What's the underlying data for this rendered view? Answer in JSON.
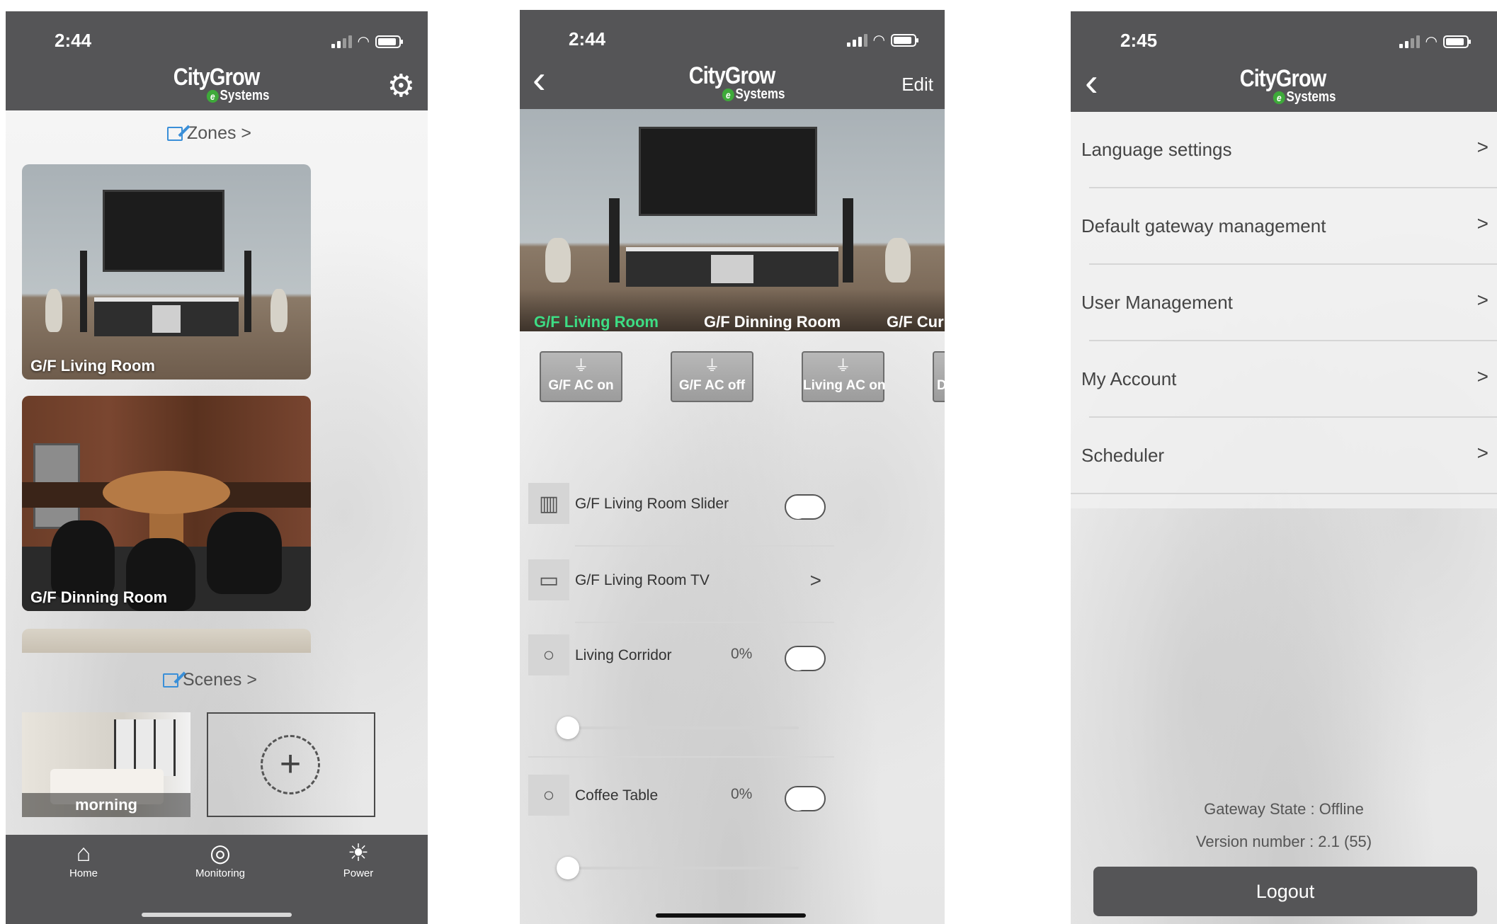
{
  "status": {
    "time_1": "2:44",
    "time_2": "2:44",
    "time_3": "2:45"
  },
  "brand": {
    "name": "CityGrow",
    "sub": "Systems",
    "logo_mark": "e"
  },
  "icons": {
    "settings": "⚙",
    "back": "‹",
    "chevron": ">",
    "home": "⌂",
    "monitoring": "◎",
    "power": "☀",
    "add": "+",
    "lamp": "⏚",
    "tv": "▭",
    "slider": "▥",
    "bulb": "💡"
  },
  "home_screen": {
    "zones_title": "Zones >",
    "zones": [
      "G/F Living Room",
      "G/F Dinning Room"
    ],
    "scenes_title": "Scenes >",
    "scene_card": "morning",
    "tabbar": {
      "home": "Home",
      "monitoring": "Monitoring",
      "power": "Power"
    }
  },
  "zone_screen": {
    "edit_label": "Edit",
    "room_tabs": [
      "G/F Living Room",
      "G/F Dinning Room",
      "G/F Cur"
    ],
    "active_tab_color": "#3ddc84",
    "scene_buttons": [
      "G/F AC on",
      "G/F AC off",
      "Living AC on",
      "D"
    ],
    "devices": [
      {
        "name": "G/F Living Room Slider"
      },
      {
        "name": "G/F Living Room TV"
      },
      {
        "name": "Living Corridor",
        "level": "0%"
      },
      {
        "name": "Coffee Table",
        "level": "0%"
      }
    ]
  },
  "settings_screen": {
    "rows": [
      "Language settings",
      "Default gateway management",
      "User Management",
      "My Account",
      "Scheduler"
    ],
    "gateway_state": "Gateway State : Offline",
    "version": "Version number : 2.1 (55)",
    "logout": "Logout"
  },
  "colors": {
    "header": "#555557",
    "accent_green": "#3ddc84",
    "edit_blue": "#3a8fd8"
  }
}
